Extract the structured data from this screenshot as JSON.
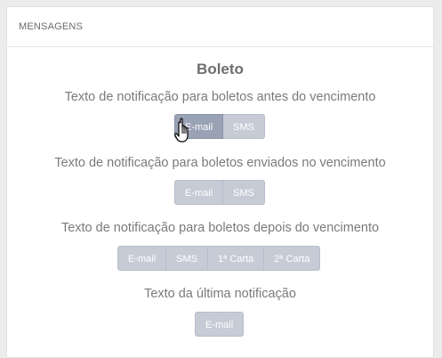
{
  "panel": {
    "header": "MENSAGENS"
  },
  "section": {
    "title": "Boleto"
  },
  "rows": [
    {
      "label": "Texto de notificação para boletos antes do vencimento",
      "buttons": [
        "E-mail",
        "SMS"
      ]
    },
    {
      "label": "Texto de notificação para boletos enviados no vencimento",
      "buttons": [
        "E-mail",
        "SMS"
      ]
    },
    {
      "label": "Texto de notificação para boletos depois do vencimento",
      "buttons": [
        "E-mail",
        "SMS",
        "1ª Carta",
        "2ª Carta"
      ]
    },
    {
      "label": "Texto da última notificação",
      "buttons": [
        "E-mail"
      ]
    }
  ],
  "colors": {
    "button_bg": "#c6cbd6",
    "button_active_bg": "#9aa2b5",
    "text": "#7a7a7a"
  }
}
